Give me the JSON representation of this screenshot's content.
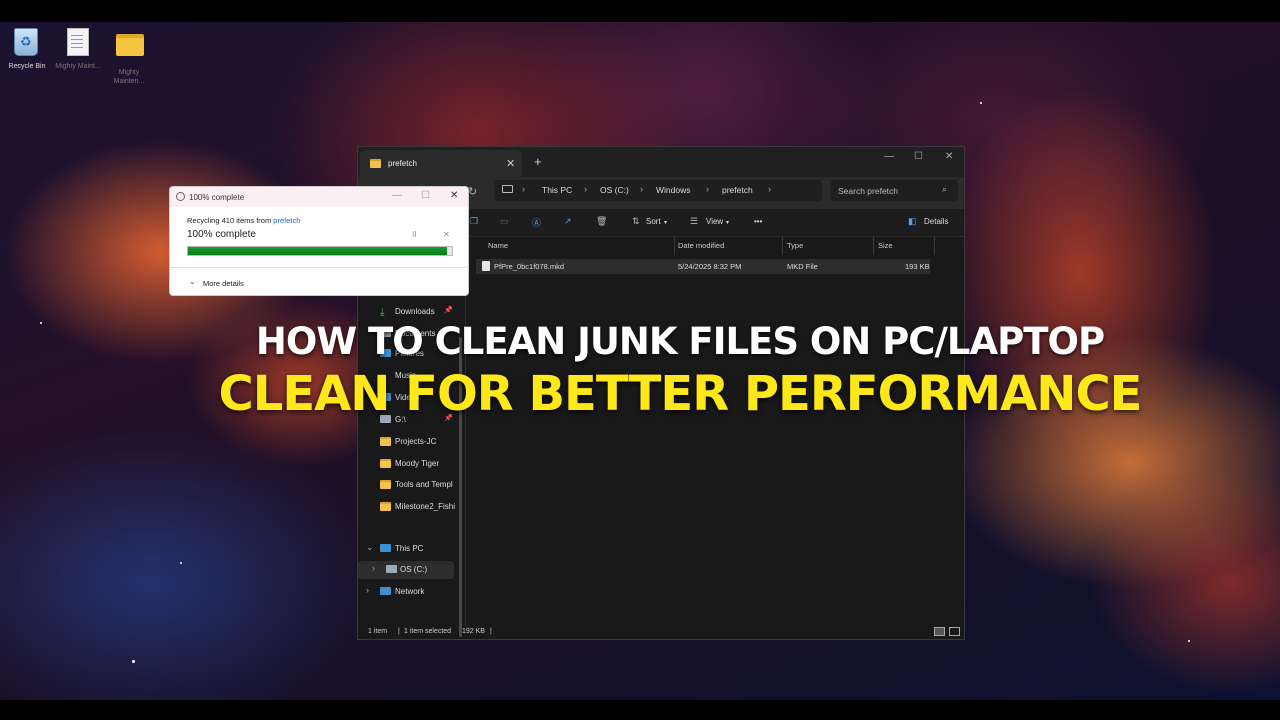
{
  "desktop": {
    "icons": [
      {
        "label": "Recycle Bin"
      },
      {
        "label": "Mighty Maint..."
      },
      {
        "label": "Mighty Mainten..."
      }
    ]
  },
  "explorer": {
    "tab_title": "prefetch",
    "tab_close": "✕",
    "new_tab": "+",
    "window_controls": {
      "minimize": "—",
      "maximize": "☐",
      "close": "✕"
    },
    "nav": {
      "back": "←",
      "forward": "→",
      "up": "↑",
      "refresh": "↻"
    },
    "breadcrumbs": [
      "This PC",
      "OS (C:)",
      "Windows",
      "prefetch"
    ],
    "search_placeholder": "Search prefetch",
    "toolbar": {
      "sort": "Sort",
      "view": "View",
      "more": "•••",
      "details": "Details"
    },
    "nav_pane": [
      {
        "label": "Downloads",
        "pinned": true
      },
      {
        "label": "Documents",
        "pinned": true
      },
      {
        "label": "Pictures",
        "pinned": true
      },
      {
        "label": "Music",
        "pinned": true
      },
      {
        "label": "Videos",
        "pinned": true
      },
      {
        "label": "G:\\",
        "pinned": true
      },
      {
        "label": "Projects-JC",
        "pinned": false
      },
      {
        "label": "Moody Tiger",
        "pinned": false
      },
      {
        "label": "Tools and Templ",
        "pinned": false
      },
      {
        "label": "Milestone2_Fishi",
        "pinned": false
      }
    ],
    "this_pc": "This PC",
    "os_drive": "OS (C:)",
    "network": "Network",
    "columns": [
      "Name",
      "Date modified",
      "Type",
      "Size"
    ],
    "files": [
      {
        "name": "PfPre_0bc1f078.mkd",
        "date": "5/24/2025 8:32 PM",
        "type": "MKD File",
        "size": "193 KB"
      }
    ],
    "status": {
      "items": "1 item",
      "selected": "1 item selected",
      "sel_size": "192 KB"
    }
  },
  "dialog": {
    "title": "100% complete",
    "recycling_prefix": "Recycling 410 items from",
    "recycling_link": "prefetch",
    "percent_label": "100% complete",
    "progress": 0.98,
    "pause": "II",
    "cancel": "✕",
    "more_details": "More details"
  },
  "overlay": {
    "line1": "HOW TO CLEAN JUNK FILES ON PC/LAPTOP",
    "line2": "CLEAN FOR BETTER PERFORMANCE"
  },
  "colors": {
    "accent_yellow": "#ffe81a",
    "progress_green": "#0b7a18",
    "link_blue": "#1a67c4"
  }
}
